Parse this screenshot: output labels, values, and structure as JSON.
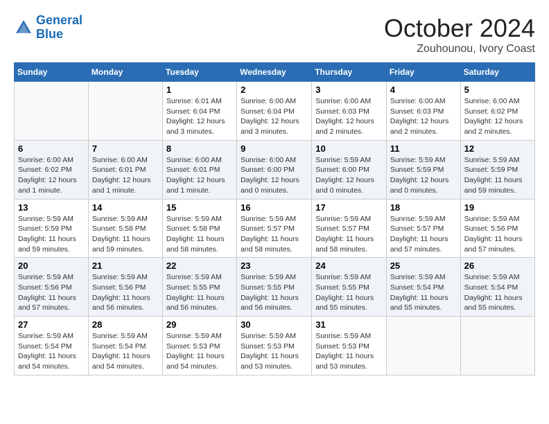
{
  "logo": {
    "line1": "General",
    "line2": "Blue"
  },
  "title": "October 2024",
  "location": "Zouhounou, Ivory Coast",
  "weekdays": [
    "Sunday",
    "Monday",
    "Tuesday",
    "Wednesday",
    "Thursday",
    "Friday",
    "Saturday"
  ],
  "weeks": [
    [
      {
        "day": "",
        "info": ""
      },
      {
        "day": "",
        "info": ""
      },
      {
        "day": "1",
        "info": "Sunrise: 6:01 AM\nSunset: 6:04 PM\nDaylight: 12 hours and 3 minutes."
      },
      {
        "day": "2",
        "info": "Sunrise: 6:00 AM\nSunset: 6:04 PM\nDaylight: 12 hours and 3 minutes."
      },
      {
        "day": "3",
        "info": "Sunrise: 6:00 AM\nSunset: 6:03 PM\nDaylight: 12 hours and 2 minutes."
      },
      {
        "day": "4",
        "info": "Sunrise: 6:00 AM\nSunset: 6:03 PM\nDaylight: 12 hours and 2 minutes."
      },
      {
        "day": "5",
        "info": "Sunrise: 6:00 AM\nSunset: 6:02 PM\nDaylight: 12 hours and 2 minutes."
      }
    ],
    [
      {
        "day": "6",
        "info": "Sunrise: 6:00 AM\nSunset: 6:02 PM\nDaylight: 12 hours and 1 minute."
      },
      {
        "day": "7",
        "info": "Sunrise: 6:00 AM\nSunset: 6:01 PM\nDaylight: 12 hours and 1 minute."
      },
      {
        "day": "8",
        "info": "Sunrise: 6:00 AM\nSunset: 6:01 PM\nDaylight: 12 hours and 1 minute."
      },
      {
        "day": "9",
        "info": "Sunrise: 6:00 AM\nSunset: 6:00 PM\nDaylight: 12 hours and 0 minutes."
      },
      {
        "day": "10",
        "info": "Sunrise: 5:59 AM\nSunset: 6:00 PM\nDaylight: 12 hours and 0 minutes."
      },
      {
        "day": "11",
        "info": "Sunrise: 5:59 AM\nSunset: 5:59 PM\nDaylight: 12 hours and 0 minutes."
      },
      {
        "day": "12",
        "info": "Sunrise: 5:59 AM\nSunset: 5:59 PM\nDaylight: 11 hours and 59 minutes."
      }
    ],
    [
      {
        "day": "13",
        "info": "Sunrise: 5:59 AM\nSunset: 5:59 PM\nDaylight: 11 hours and 59 minutes."
      },
      {
        "day": "14",
        "info": "Sunrise: 5:59 AM\nSunset: 5:58 PM\nDaylight: 11 hours and 59 minutes."
      },
      {
        "day": "15",
        "info": "Sunrise: 5:59 AM\nSunset: 5:58 PM\nDaylight: 11 hours and 58 minutes."
      },
      {
        "day": "16",
        "info": "Sunrise: 5:59 AM\nSunset: 5:57 PM\nDaylight: 11 hours and 58 minutes."
      },
      {
        "day": "17",
        "info": "Sunrise: 5:59 AM\nSunset: 5:57 PM\nDaylight: 11 hours and 58 minutes."
      },
      {
        "day": "18",
        "info": "Sunrise: 5:59 AM\nSunset: 5:57 PM\nDaylight: 11 hours and 57 minutes."
      },
      {
        "day": "19",
        "info": "Sunrise: 5:59 AM\nSunset: 5:56 PM\nDaylight: 11 hours and 57 minutes."
      }
    ],
    [
      {
        "day": "20",
        "info": "Sunrise: 5:59 AM\nSunset: 5:56 PM\nDaylight: 11 hours and 57 minutes."
      },
      {
        "day": "21",
        "info": "Sunrise: 5:59 AM\nSunset: 5:56 PM\nDaylight: 11 hours and 56 minutes."
      },
      {
        "day": "22",
        "info": "Sunrise: 5:59 AM\nSunset: 5:55 PM\nDaylight: 11 hours and 56 minutes."
      },
      {
        "day": "23",
        "info": "Sunrise: 5:59 AM\nSunset: 5:55 PM\nDaylight: 11 hours and 56 minutes."
      },
      {
        "day": "24",
        "info": "Sunrise: 5:59 AM\nSunset: 5:55 PM\nDaylight: 11 hours and 55 minutes."
      },
      {
        "day": "25",
        "info": "Sunrise: 5:59 AM\nSunset: 5:54 PM\nDaylight: 11 hours and 55 minutes."
      },
      {
        "day": "26",
        "info": "Sunrise: 5:59 AM\nSunset: 5:54 PM\nDaylight: 11 hours and 55 minutes."
      }
    ],
    [
      {
        "day": "27",
        "info": "Sunrise: 5:59 AM\nSunset: 5:54 PM\nDaylight: 11 hours and 54 minutes."
      },
      {
        "day": "28",
        "info": "Sunrise: 5:59 AM\nSunset: 5:54 PM\nDaylight: 11 hours and 54 minutes."
      },
      {
        "day": "29",
        "info": "Sunrise: 5:59 AM\nSunset: 5:53 PM\nDaylight: 11 hours and 54 minutes."
      },
      {
        "day": "30",
        "info": "Sunrise: 5:59 AM\nSunset: 5:53 PM\nDaylight: 11 hours and 53 minutes."
      },
      {
        "day": "31",
        "info": "Sunrise: 5:59 AM\nSunset: 5:53 PM\nDaylight: 11 hours and 53 minutes."
      },
      {
        "day": "",
        "info": ""
      },
      {
        "day": "",
        "info": ""
      }
    ]
  ]
}
